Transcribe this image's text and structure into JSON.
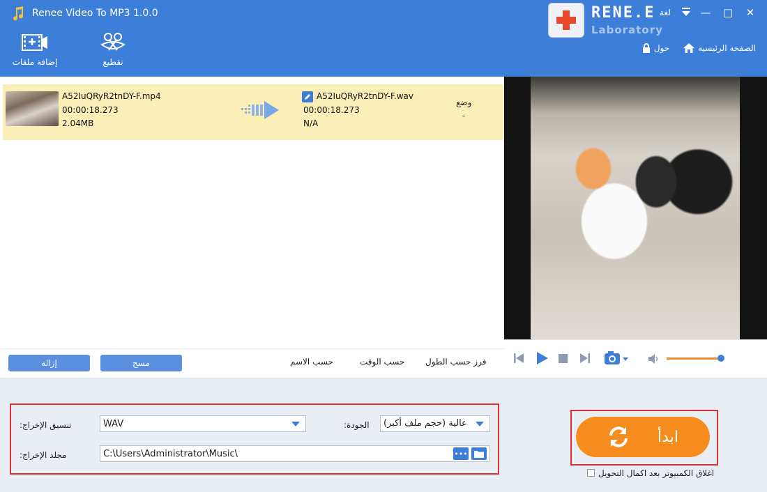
{
  "app": {
    "title": "Renee Video To MP3 1.0.0",
    "language_label": "لغة"
  },
  "logo": {
    "name": "RENE.E",
    "sub": "Laboratory"
  },
  "nav": {
    "home_label": "الصفحة الرئيسية",
    "about_label": "حول"
  },
  "toolbar": {
    "add_files_label": "إضافة ملفات",
    "cut_label": "تقطيع"
  },
  "file": {
    "source_name": "A52IuQRyR2tnDY-F.mp4",
    "source_duration": "00:00:18.273",
    "source_size": "2.04MB",
    "output_name": "A52IuQRyR2tnDY-F.wav",
    "output_duration": "00:00:18.273",
    "output_size": "N/A",
    "status_header": "وضع",
    "status_value": "-"
  },
  "list_actions": {
    "remove_label": "إزالة",
    "clear_label": "مسح"
  },
  "sort": {
    "by_length": "فرز حسب الطول",
    "by_time": "حسب الوقت",
    "by_name": "حسب الاسم"
  },
  "settings": {
    "format_label": ":تنسيق الإخراج",
    "format_value": "WAV",
    "quality_label": ":الجودة",
    "quality_value": "عالية (حجم ملف أكبر)",
    "folder_label": ":مجلد الإخراج",
    "folder_value": "C:\\Users\\Administrator\\Music\\",
    "browse_label": "•••"
  },
  "start": {
    "label": "ابدأ",
    "shutdown_label": "اغلاق الكمبيوتر بعد اكمال التحويل"
  },
  "player": {
    "volume": 0.95
  },
  "colors": {
    "accent": "#3d7ed8",
    "start": "#f78c1e",
    "highlight_row": "#fbefb7",
    "highlight_border": "#e22d3a"
  }
}
